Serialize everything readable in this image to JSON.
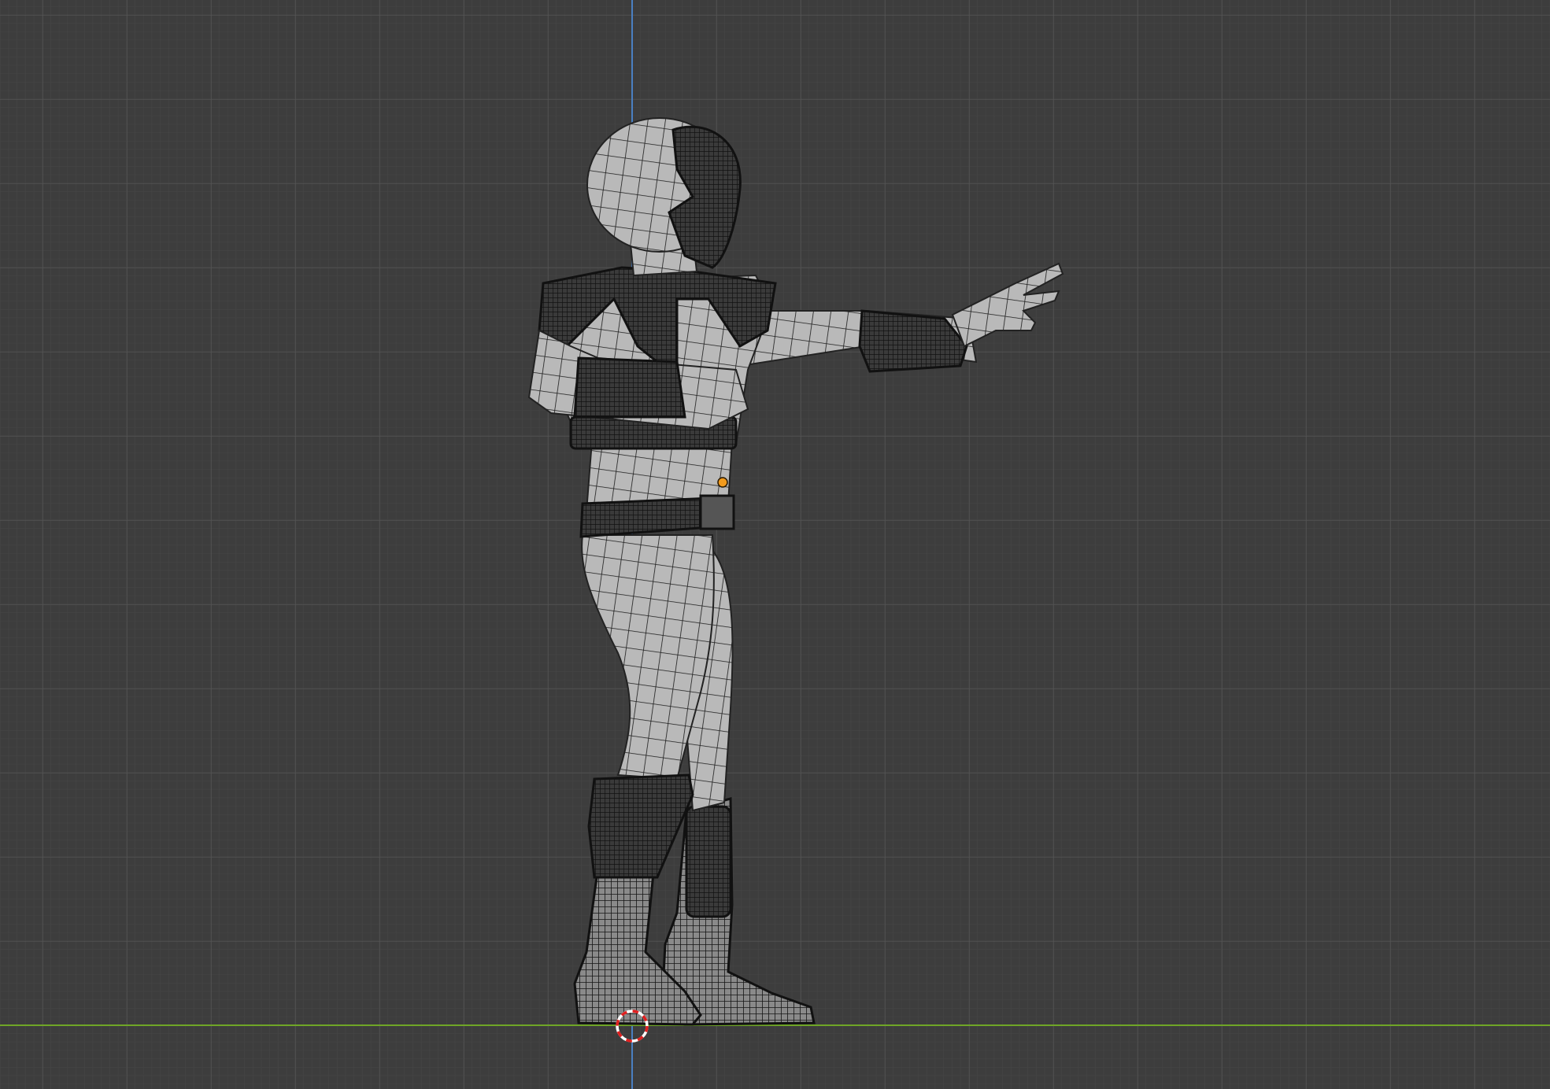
{
  "viewport": {
    "view": "3d-viewport-orthographic-side",
    "shading": "solid-wireframe-overlay",
    "colors": {
      "background": "#3d3d3d",
      "grid_minor": "#464646",
      "grid_major": "#545454",
      "axis_x": "#6fa626",
      "axis_z": "#4a7fc1",
      "mesh_fill": "#b8b8b8",
      "mesh_wire": "#1a1a1a",
      "armor_fill": "#2a2a2a",
      "origin_dot": "#f29b1d",
      "cursor_red": "#e02020",
      "cursor_white": "#ffffff"
    },
    "icons": [
      "3d-cursor-icon",
      "object-origin-icon"
    ],
    "objects": [
      {
        "name": "character-mesh",
        "selected": false
      }
    ]
  }
}
